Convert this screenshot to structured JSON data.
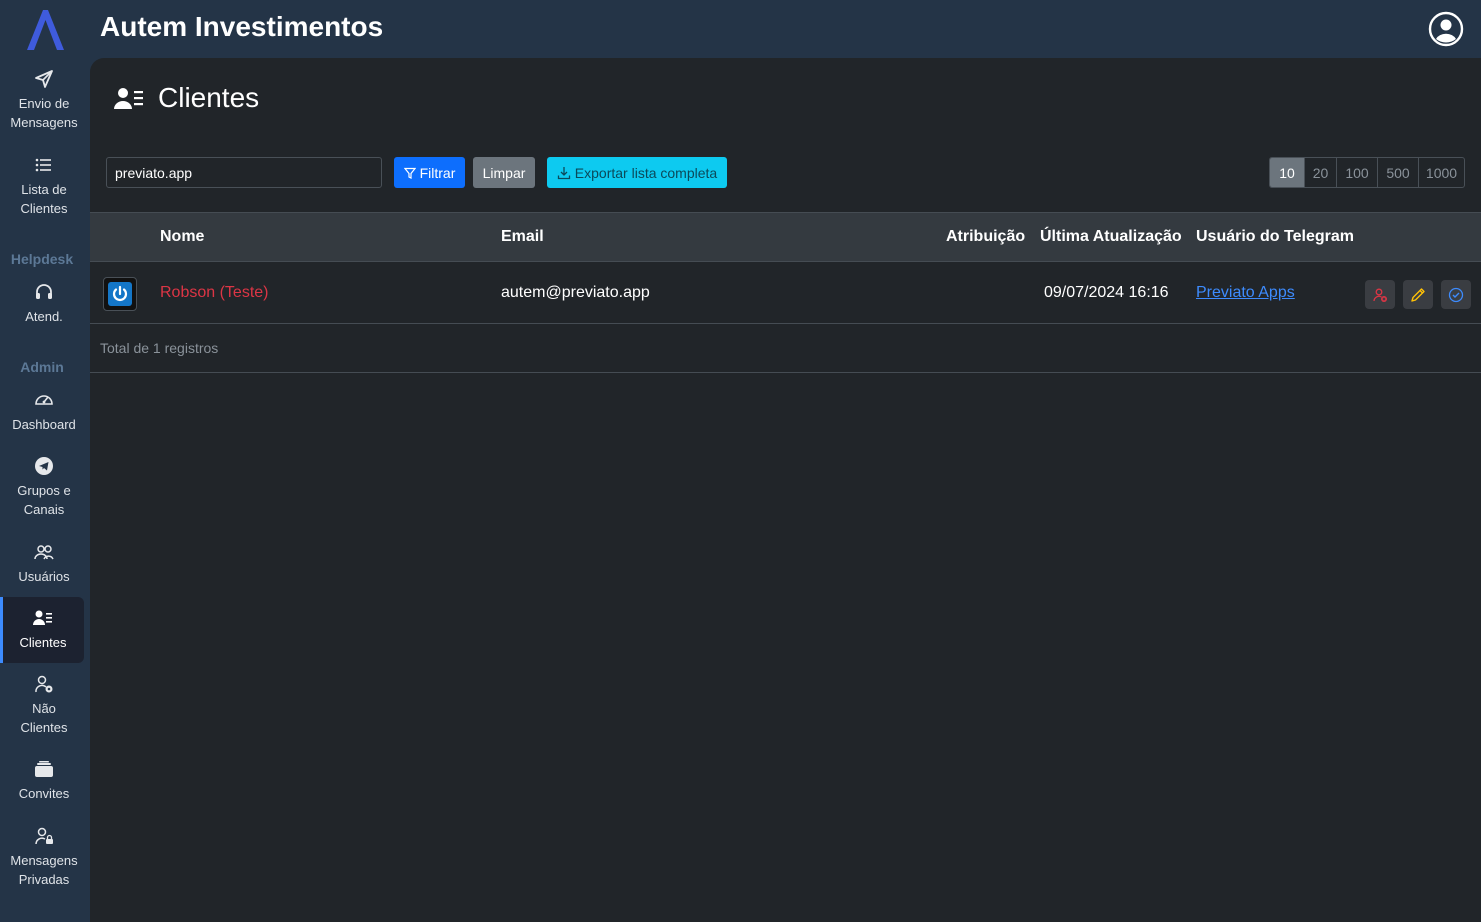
{
  "app": {
    "title": "Autem Investimentos"
  },
  "sidebar": {
    "items": [
      {
        "label1": "Envio de",
        "label2": "Mensagens",
        "icon": "send-icon"
      },
      {
        "label1": "Lista de",
        "label2": "Clientes",
        "icon": "list-icon"
      },
      {
        "label1": "Atend.",
        "label2": "",
        "icon": "headset-icon"
      },
      {
        "label1": "Dashboard",
        "label2": "",
        "icon": "speedometer-icon"
      },
      {
        "label1": "Grupos e",
        "label2": "Canais",
        "icon": "telegram-icon"
      },
      {
        "label1": "Usuários",
        "label2": "",
        "icon": "people-icon"
      },
      {
        "label1": "Clientes",
        "label2": "",
        "icon": "person-lines-icon",
        "active": true
      },
      {
        "label1": "Não",
        "label2": "Clientes",
        "icon": "person-gear-icon"
      },
      {
        "label1": "Convites",
        "label2": "",
        "icon": "ticket-icon"
      },
      {
        "label1": "Mensagens",
        "label2": "Privadas",
        "icon": "person-lock-icon"
      }
    ],
    "headings": {
      "helpdesk": "Helpdesk",
      "admin": "Admin"
    }
  },
  "page": {
    "title": "Clientes"
  },
  "toolbar": {
    "search_value": "previato.app",
    "filter_label": "Filtrar",
    "clear_label": "Limpar",
    "export_label": "Exportar lista completa",
    "page_sizes": [
      "10",
      "20",
      "100",
      "500",
      "1000"
    ],
    "selected_page_size": "10"
  },
  "table": {
    "columns": [
      "Nome",
      "Email",
      "Atribuição",
      "Última Atualização",
      "Usuário do Telegram"
    ],
    "rows": [
      {
        "nome": "Robson (Teste)",
        "email": "autem@previato.app",
        "atribuicao": "",
        "ultima_atualizacao": "09/07/2024 16:16",
        "usuario_telegram": "Previato Apps"
      }
    ],
    "total_text": "Total de 1 registros"
  },
  "colors": {
    "accent": "#0d6efd",
    "info": "#0dcaf0",
    "danger": "#dc3545",
    "warning": "#ffc107",
    "sidebar_bg": "#243447",
    "main_bg": "#212529"
  }
}
